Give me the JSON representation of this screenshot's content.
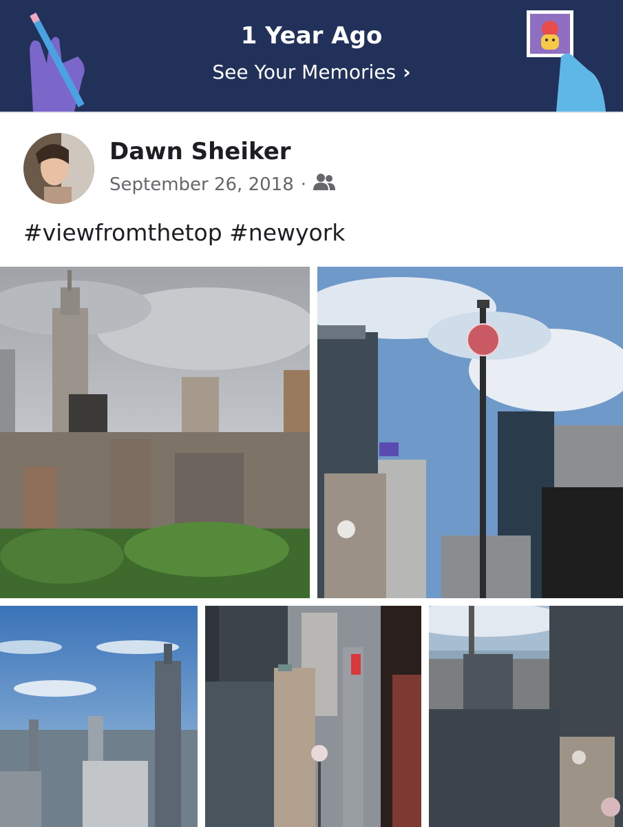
{
  "banner": {
    "title": "1 Year Ago",
    "link_label": "See Your Memories",
    "link_icon": "chevron-right-icon"
  },
  "post": {
    "author": "Dawn Sheiker",
    "date": "September 26, 2018",
    "separator": "·",
    "audience_icon": "friends-icon",
    "text": "#viewfromthetop #newyork"
  },
  "photos": [
    {
      "subject": "empire-state-building-skyline"
    },
    {
      "subject": "times-square-ball-mast"
    },
    {
      "subject": "empire-state-blue-sky"
    },
    {
      "subject": "times-square-street-view"
    },
    {
      "subject": "midtown-towers-river"
    }
  ],
  "colors": {
    "banner_bg": "#22315a",
    "text_primary": "#1c1e21",
    "text_secondary": "#65676b"
  }
}
